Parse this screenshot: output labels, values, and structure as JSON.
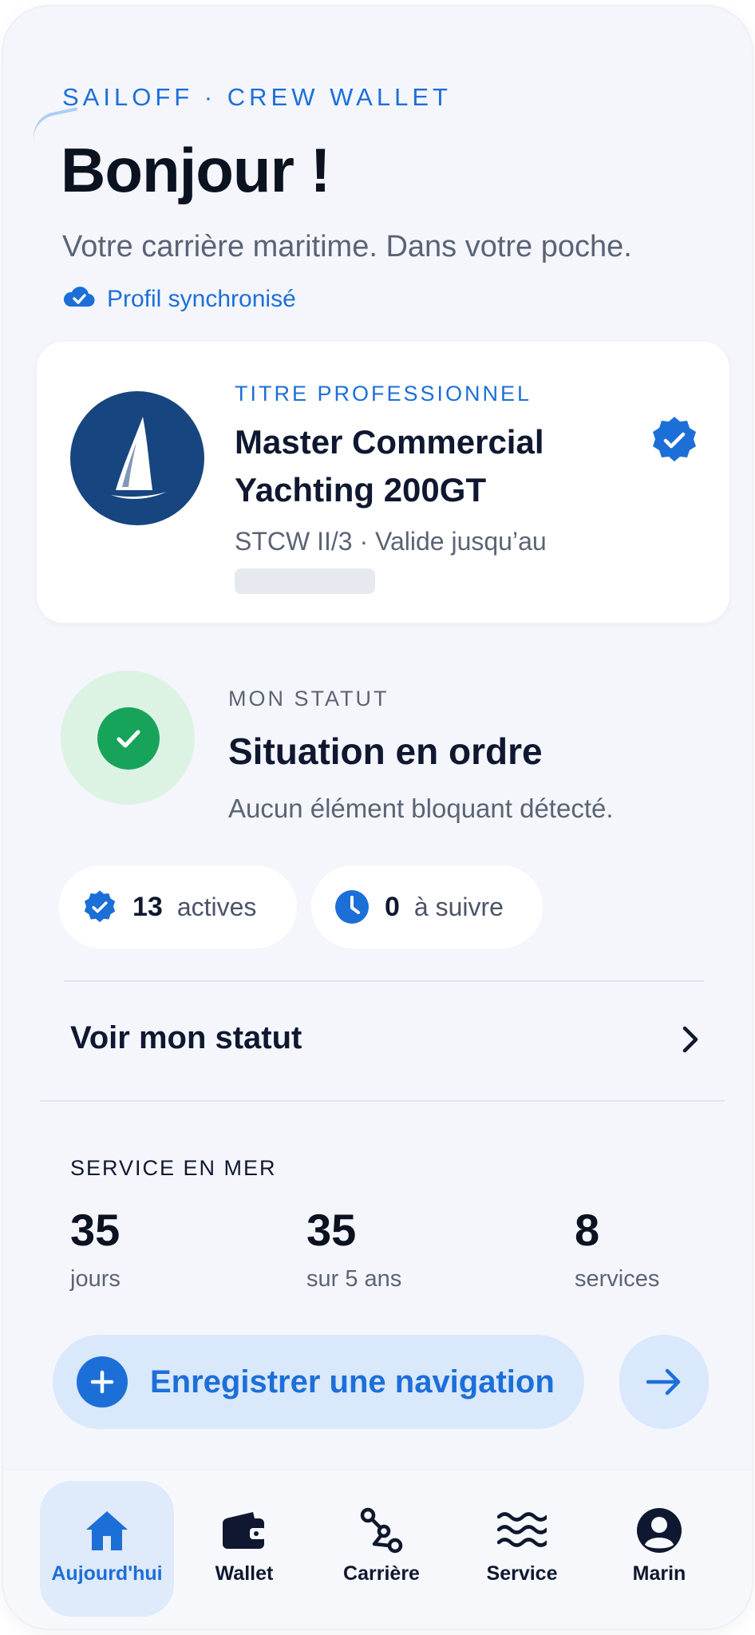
{
  "header": {
    "brand": "SAILOFF · CREW WALLET",
    "greeting": "Bonjour !",
    "tagline": "Votre carrière maritime. Dans votre poche.",
    "sync_status": "Profil synchronisé"
  },
  "title_card": {
    "kicker": "TITRE PROFESSIONNEL",
    "title": "Master Commercial Yachting 200GT",
    "subtitle": "STCW II/3 · Valide jusqu’au",
    "logo_icon": "sailboat-icon",
    "badge_icon": "verified-badge-icon"
  },
  "status": {
    "kicker": "MON STATUT",
    "title": "Situation en ordre",
    "description": "Aucun élément bloquant détecté.",
    "color": "#17a45a",
    "pills": [
      {
        "count": "13",
        "label": "actives",
        "icon": "verified-badge-icon"
      },
      {
        "count": "0",
        "label": "à suivre",
        "icon": "clock-icon"
      }
    ],
    "link_label": "Voir mon statut"
  },
  "sea_service": {
    "kicker": "SERVICE EN MER",
    "stats": [
      {
        "value": "35",
        "label": "jours"
      },
      {
        "value": "35",
        "label": "sur 5 ans"
      },
      {
        "value": "8",
        "label": "services"
      }
    ],
    "cta_label": "Enregistrer une navigation"
  },
  "tabs": [
    {
      "label": "Aujourd'hui",
      "icon": "home-icon",
      "active": true
    },
    {
      "label": "Wallet",
      "icon": "wallet-icon",
      "active": false
    },
    {
      "label": "Carrière",
      "icon": "career-path-icon",
      "active": false
    },
    {
      "label": "Service",
      "icon": "waves-icon",
      "active": false
    },
    {
      "label": "Marin",
      "icon": "profile-icon",
      "active": false
    }
  ],
  "colors": {
    "accent": "#1d6fd8",
    "success": "#17a45a",
    "navy": "#17457f",
    "background": "#f4f6fb"
  }
}
